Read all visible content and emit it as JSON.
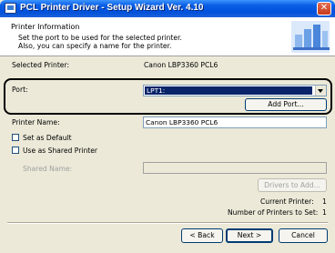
{
  "window": {
    "title": "PCL Printer Driver - Setup Wizard Ver. 4.10",
    "close_symbol": "✕"
  },
  "header": {
    "title": "Printer Information",
    "desc_line1": "Set the port to be used for the selected printer.",
    "desc_line2": "Also, you can specify a name for the printer."
  },
  "selected_printer": {
    "label": "Selected Printer:",
    "value": "Canon LBP3360 PCL6"
  },
  "port": {
    "label": "Port:",
    "value": "LPT1:",
    "add_port_label": "Add Port..."
  },
  "printer_name": {
    "label": "Printer Name:",
    "value": "Canon LBP3360 PCL6"
  },
  "options": {
    "set_default_label": "Set as Default",
    "shared_label": "Use as Shared Printer"
  },
  "shared_name": {
    "label": "Shared Name:",
    "value": ""
  },
  "drivers_button": "Drivers to Add...",
  "status": {
    "current_printer_label": "Current Printer:",
    "current_printer_value": "1",
    "printers_to_set_label": "Number of Printers to Set:",
    "printers_to_set_value": "1"
  },
  "footer": {
    "back_label": "< Back",
    "next_label": "Next >",
    "cancel_label": "Cancel"
  },
  "colors": {
    "title_bar": "#0050dc",
    "dialog_bg": "#ece9d8",
    "selection": "#0a246a"
  }
}
